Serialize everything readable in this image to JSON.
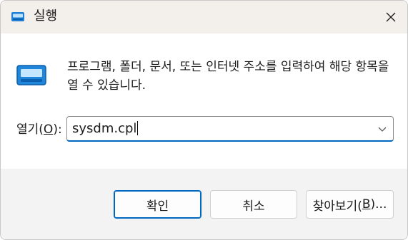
{
  "window": {
    "title": "실행",
    "close_icon": "close-icon",
    "app_icon": "run-icon"
  },
  "content": {
    "description": "프로그램, 폴더, 문서, 또는 인터넷 주소를 입력하여 해당 항목을 열 수 있습니다.",
    "open_label_prefix": "열기(",
    "open_label_accel": "O",
    "open_label_suffix": "):",
    "input_value": "sysdm.cpl",
    "dropdown_icon": "chevron-down-icon"
  },
  "buttons": {
    "ok_label": "확인",
    "cancel_label": "취소",
    "browse_prefix": "찾아보기(",
    "browse_accel": "B",
    "browse_suffix": ")..."
  },
  "colors": {
    "accent": "#0067c0",
    "titlebar": "#f3efea",
    "footer": "#f3f3f3"
  }
}
